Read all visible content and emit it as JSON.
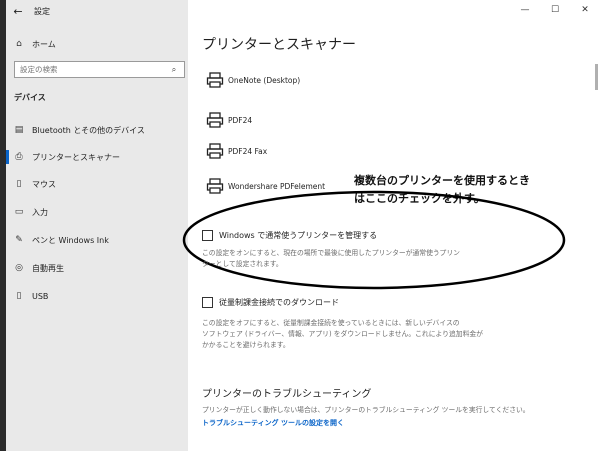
{
  "window": {
    "app_title": "設定",
    "back": "←",
    "minimize": "—",
    "maximize": "☐",
    "close": "✕"
  },
  "sidebar": {
    "home": "ホーム",
    "search_placeholder": "設定の検索",
    "section": "デバイス",
    "items": [
      {
        "label": "Bluetooth とその他のデバイス",
        "icon": "device-icon"
      },
      {
        "label": "プリンターとスキャナー",
        "icon": "printer-icon",
        "active": true
      },
      {
        "label": "マウス",
        "icon": "mouse-icon"
      },
      {
        "label": "入力",
        "icon": "keyboard-icon"
      },
      {
        "label": "ペンと Windows Ink",
        "icon": "pen-icon"
      },
      {
        "label": "自動再生",
        "icon": "autoplay-icon"
      },
      {
        "label": "USB",
        "icon": "usb-icon"
      }
    ]
  },
  "main": {
    "title": "プリンターとスキャナー",
    "printers": [
      "OneNote (Desktop)",
      "PDF24",
      "PDF24 Fax",
      "Wondershare PDFelement"
    ],
    "default_printer": {
      "label": "Windows で通常使うプリンターを管理する",
      "checked": false,
      "desc1": "この設定をオンにすると、現在の場所で最後に使用したプリンターが通常使うプリン",
      "desc2": "ターとして設定されます。"
    },
    "metered": {
      "label": "従量制課金接続でのダウンロード",
      "checked": false,
      "desc1": "この設定をオフにすると、従量制課金接続を使っているときには、新しいデバイスの",
      "desc2": "ソフトウェア (ドライバー、情報、アプリ) をダウンロードしません。これにより追加料金が",
      "desc3": "かかることを避けられます。"
    },
    "troubleshoot": {
      "title": "プリンターのトラブルシューティング",
      "desc": "プリンターが正しく動作しない場合は、プリンターのトラブルシューティング ツールを実行してください。",
      "link": "トラブルシューティング ツールの設定を開く"
    }
  },
  "annotation": {
    "line1": "複数台のプリンターを使用するとき",
    "line2": "はここのチェックを外す。"
  },
  "colors": {
    "accent": "#0a64c8",
    "sidebar_bg": "#e9e9e9"
  }
}
